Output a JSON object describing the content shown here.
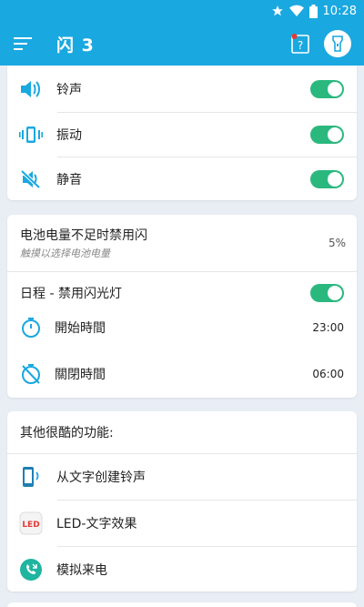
{
  "status": {
    "time": "10:28"
  },
  "app": {
    "title": "闪 3"
  },
  "sounds": [
    {
      "label": "铃声",
      "icon": "speaker-icon",
      "on": true
    },
    {
      "label": "振动",
      "icon": "vibrate-icon",
      "on": true
    },
    {
      "label": "静音",
      "icon": "mute-icon",
      "on": true
    }
  ],
  "battery": {
    "title": "电池电量不足时禁用闪",
    "subtitle": "触摸以选择电池电量",
    "value": "5%"
  },
  "schedule": {
    "title": "日程 - 禁用闪光灯",
    "on": true,
    "start_label": "開始時間",
    "start_time": "23:00",
    "end_label": "關閉時間",
    "end_time": "06:00"
  },
  "features": {
    "title": "其他很酷的功能:",
    "items": [
      {
        "label": "从文字创建铃声",
        "icon": "phone-ringtone-icon"
      },
      {
        "label": "LED-文字效果",
        "icon": "led-icon",
        "icon_text": "LED"
      },
      {
        "label": "模拟来电",
        "icon": "incoming-call-icon"
      }
    ]
  },
  "colors": {
    "primary": "#1aa8e0",
    "toggle_on": "#2ab87e",
    "icon": "#1aa8e0"
  }
}
